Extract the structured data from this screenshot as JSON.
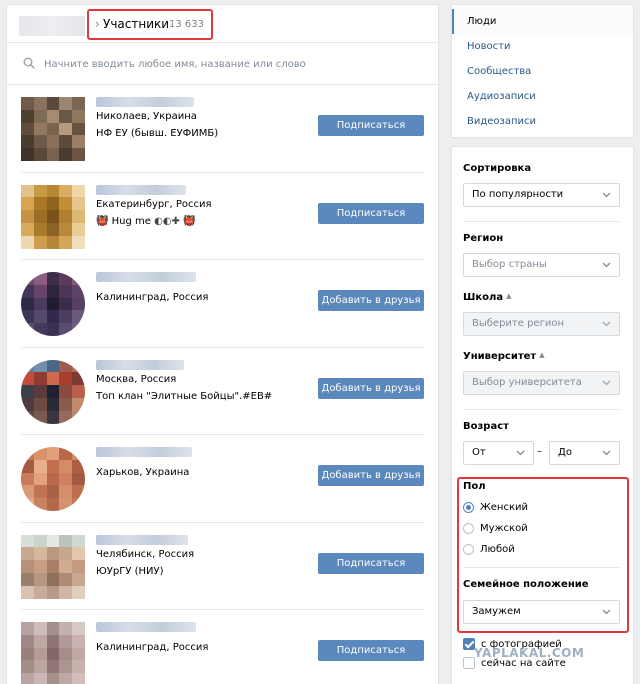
{
  "header": {
    "title": "Участники",
    "count": "13 633",
    "separator": "›"
  },
  "search": {
    "placeholder": "Начните вводить любое имя, название или слово"
  },
  "people": [
    {
      "name_blur_width": 98,
      "line1": "Николаев, Украина",
      "line2": "НФ ЕУ (бывш. ЕУФИМБ)",
      "button": "Подписаться",
      "avatar_palette": [
        "#6e5b4b",
        "#8a735e",
        "#5a4a3d",
        "#9c8670",
        "#7b6654",
        "#4f4034",
        "#7f6a56",
        "#a58b72",
        "#6a5847",
        "#8d775f",
        "#5e4d3e",
        "#93795f",
        "#7a634f",
        "#b59b80",
        "#66533f",
        "#4b3c30",
        "#6d5a48",
        "#89705a",
        "#5c4a3a",
        "#9a8066",
        "#403228",
        "#5a4838",
        "#796350",
        "#4a3b2e",
        "#6b5645"
      ],
      "avatar_round": false
    },
    {
      "name_blur_width": 90,
      "line1": "Екатеринбург, Россия",
      "line2": "Hug me",
      "button": "Подписаться",
      "avatar_palette": [
        "#e1c48d",
        "#c99a45",
        "#b88634",
        "#d9ad62",
        "#eed6a6",
        "#d6a54e",
        "#a97726",
        "#8f6420",
        "#c28e36",
        "#e4c68c",
        "#c69244",
        "#9c6d24",
        "#7a531a",
        "#b07f2f",
        "#ddb874",
        "#d7ab5c",
        "#a87a2c",
        "#8c6322",
        "#b8893a",
        "#e9cd97",
        "#edd8b0",
        "#cf9e4d",
        "#b5863a",
        "#d3a658",
        "#f0dfbd"
      ],
      "avatar_round": false
    },
    {
      "name_blur_width": 100,
      "line1": "Калининград, Россия",
      "line2": "",
      "button": "Добавить в друзья",
      "avatar_palette": [
        "#6d4a6a",
        "#8a5d82",
        "#3e2d4b",
        "#5c3a5a",
        "#7a5a78",
        "#42345a",
        "#6a4468",
        "#2e2440",
        "#4e3556",
        "#5d4368",
        "#2f2a44",
        "#4a3a5e",
        "#1f1c30",
        "#3a2d4c",
        "#56405f",
        "#3d3556",
        "#564a6c",
        "#33294a",
        "#4c3c60",
        "#6a5a7c",
        "#5a4e70",
        "#443a5a",
        "#3a3052",
        "#5a4c6c",
        "#6e5e80"
      ],
      "avatar_round": true
    },
    {
      "name_blur_width": 88,
      "line1": "Москва, Россия",
      "line2": "Топ клан \"Элитные Бойцы\".#EB#",
      "button": "Добавить в друзья",
      "avatar_palette": [
        "#5f7d9e",
        "#7590ac",
        "#4c6685",
        "#a05a4e",
        "#b26c5a",
        "#c24b3a",
        "#8f3d32",
        "#d1694f",
        "#a63f30",
        "#7c3a34",
        "#3a3f4c",
        "#5a3a3a",
        "#1f2230",
        "#8a4a3e",
        "#b8604b",
        "#4e3b3e",
        "#6e4a44",
        "#2a2a36",
        "#8a5a4a",
        "#c48a6e",
        "#5a4a48",
        "#7a5a50",
        "#3a343e",
        "#9a6a58",
        "#b48a72"
      ],
      "avatar_round": true
    },
    {
      "name_blur_width": 96,
      "line1": "Харьков, Украина",
      "line2": "",
      "button": "Добавить в друзья",
      "avatar_palette": [
        "#c77a5a",
        "#d9936c",
        "#e2a07a",
        "#b8684c",
        "#d08a66",
        "#a75a42",
        "#e8b08a",
        "#c4704e",
        "#d48c64",
        "#b05e44",
        "#c97a58",
        "#e4a27c",
        "#b86a4c",
        "#d08060",
        "#a45a40",
        "#d89a76",
        "#c27452",
        "#aa6246",
        "#d48e6a",
        "#bc7050",
        "#e0a684",
        "#c8825e",
        "#b4684a",
        "#d49270",
        "#c47a58"
      ],
      "avatar_round": true
    },
    {
      "name_blur_width": 92,
      "line1": "Челябинск, Россия",
      "line2": "ЮУрГУ (НИУ)",
      "button": "Подписаться",
      "avatar_palette": [
        "#d8dfd9",
        "#c9d2cb",
        "#e4e9e5",
        "#b8c4bc",
        "#cfd8d2",
        "#c9a890",
        "#d8b89c",
        "#b9987f",
        "#c6a68c",
        "#e2c7ad",
        "#b88f78",
        "#c79f84",
        "#a8806a",
        "#d0ac90",
        "#c49a80",
        "#9c7e6c",
        "#b89684",
        "#8e705e",
        "#b08a74",
        "#c8a690",
        "#d8c2b4",
        "#c7ac9c",
        "#b49a8a",
        "#d2b6a4",
        "#e0cebf"
      ],
      "avatar_round": false
    },
    {
      "name_blur_width": 100,
      "line1": "Калининград, Россия",
      "line2": "",
      "button": "Подписаться",
      "avatar_palette": [
        "#b6a3a0",
        "#cdbcb8",
        "#a48f8c",
        "#c4b0ac",
        "#d8c8c4",
        "#a08684",
        "#bfa7a4",
        "#8e7472",
        "#b29896",
        "#c9b4b0",
        "#9a807c",
        "#b69c98",
        "#826866",
        "#a88e8a",
        "#c0a8a4",
        "#a48c88",
        "#bca4a0",
        "#907674",
        "#ae9490",
        "#c8b2ae",
        "#b8a4a0",
        "#cab6b2",
        "#a6908c",
        "#bea8a4",
        "#d2beba"
      ],
      "avatar_round": false
    }
  ],
  "nav": {
    "items": [
      "Люди",
      "Новости",
      "Сообщества",
      "Аудиозаписи",
      "Видеозаписи"
    ],
    "active": 0
  },
  "filters": {
    "sort_label": "Сортировка",
    "sort_value": "По популярности",
    "region_label": "Регион",
    "region_placeholder": "Выбор страны",
    "school_label": "Школа",
    "school_placeholder": "Выберите регион",
    "university_label": "Университет",
    "university_placeholder": "Выбор университета",
    "age_label": "Возраст",
    "age_from": "От",
    "age_to": "До",
    "age_dash": "–",
    "gender_label": "Пол",
    "gender_options": [
      "Женский",
      "Мужской",
      "Любой"
    ],
    "gender_selected": 0,
    "marital_label": "Семейное положение",
    "marital_value": "Замужем",
    "with_photo": "с фотографией",
    "with_photo_checked": true,
    "online_now": "сейчас на сайте",
    "online_now_checked": false
  },
  "watermark": "YAPLAKAL.COM",
  "colors": {
    "accent": "#5181b8",
    "button": "#5b88bd",
    "link": "#2a5885",
    "highlight": "#e0393e"
  }
}
